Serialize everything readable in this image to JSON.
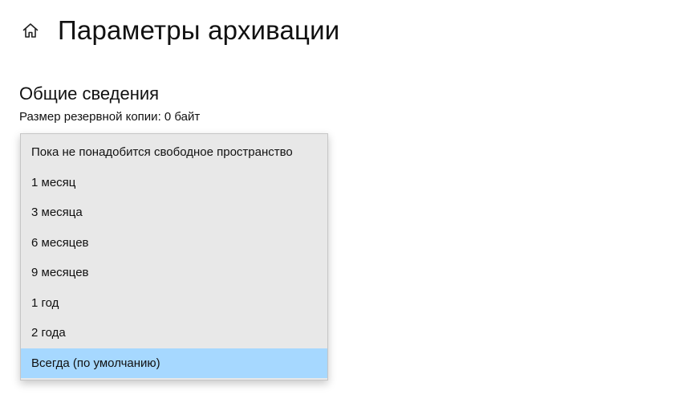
{
  "header": {
    "home_icon": "home-icon",
    "title": "Параметры архивации"
  },
  "overview": {
    "section_title": "Общие сведения",
    "backup_size": "Размер резервной копии: 0 байт"
  },
  "dropdown": {
    "selected_index": 7,
    "selected_color": "#a6d8ff",
    "options": [
      {
        "label": "Пока не понадобится свободное пространство"
      },
      {
        "label": "1 месяц"
      },
      {
        "label": "3 месяца"
      },
      {
        "label": "6 месяцев"
      },
      {
        "label": "9 месяцев"
      },
      {
        "label": "1 год"
      },
      {
        "label": "2 года"
      },
      {
        "label": "Всегда (по умолчанию)"
      }
    ]
  }
}
